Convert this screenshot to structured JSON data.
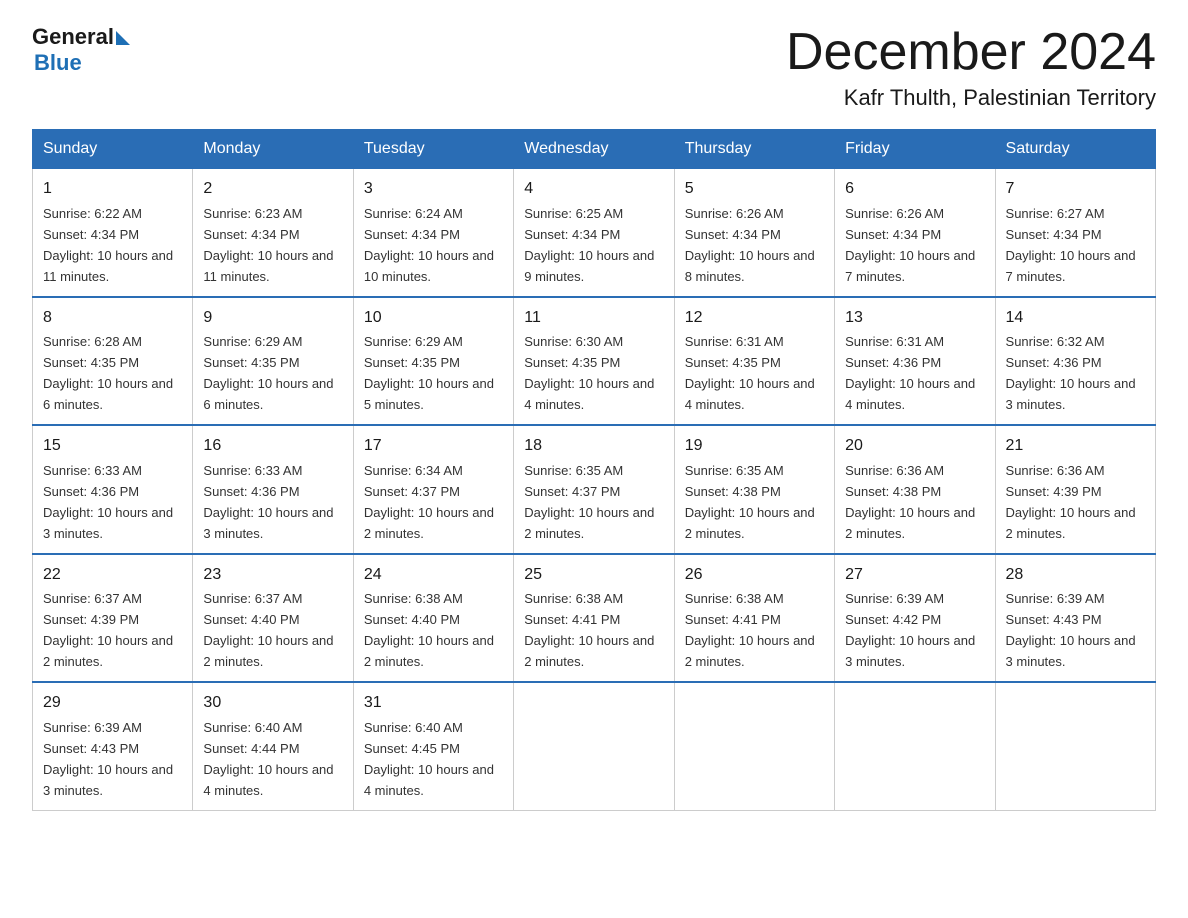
{
  "logo": {
    "general": "General",
    "blue": "Blue",
    "tagline": "Blue"
  },
  "title": "December 2024",
  "subtitle": "Kafr Thulth, Palestinian Territory",
  "days_of_week": [
    "Sunday",
    "Monday",
    "Tuesday",
    "Wednesday",
    "Thursday",
    "Friday",
    "Saturday"
  ],
  "weeks": [
    [
      {
        "num": "1",
        "sunrise": "6:22 AM",
        "sunset": "4:34 PM",
        "daylight": "10 hours and 11 minutes."
      },
      {
        "num": "2",
        "sunrise": "6:23 AM",
        "sunset": "4:34 PM",
        "daylight": "10 hours and 11 minutes."
      },
      {
        "num": "3",
        "sunrise": "6:24 AM",
        "sunset": "4:34 PM",
        "daylight": "10 hours and 10 minutes."
      },
      {
        "num": "4",
        "sunrise": "6:25 AM",
        "sunset": "4:34 PM",
        "daylight": "10 hours and 9 minutes."
      },
      {
        "num": "5",
        "sunrise": "6:26 AM",
        "sunset": "4:34 PM",
        "daylight": "10 hours and 8 minutes."
      },
      {
        "num": "6",
        "sunrise": "6:26 AM",
        "sunset": "4:34 PM",
        "daylight": "10 hours and 7 minutes."
      },
      {
        "num": "7",
        "sunrise": "6:27 AM",
        "sunset": "4:34 PM",
        "daylight": "10 hours and 7 minutes."
      }
    ],
    [
      {
        "num": "8",
        "sunrise": "6:28 AM",
        "sunset": "4:35 PM",
        "daylight": "10 hours and 6 minutes."
      },
      {
        "num": "9",
        "sunrise": "6:29 AM",
        "sunset": "4:35 PM",
        "daylight": "10 hours and 6 minutes."
      },
      {
        "num": "10",
        "sunrise": "6:29 AM",
        "sunset": "4:35 PM",
        "daylight": "10 hours and 5 minutes."
      },
      {
        "num": "11",
        "sunrise": "6:30 AM",
        "sunset": "4:35 PM",
        "daylight": "10 hours and 4 minutes."
      },
      {
        "num": "12",
        "sunrise": "6:31 AM",
        "sunset": "4:35 PM",
        "daylight": "10 hours and 4 minutes."
      },
      {
        "num": "13",
        "sunrise": "6:31 AM",
        "sunset": "4:36 PM",
        "daylight": "10 hours and 4 minutes."
      },
      {
        "num": "14",
        "sunrise": "6:32 AM",
        "sunset": "4:36 PM",
        "daylight": "10 hours and 3 minutes."
      }
    ],
    [
      {
        "num": "15",
        "sunrise": "6:33 AM",
        "sunset": "4:36 PM",
        "daylight": "10 hours and 3 minutes."
      },
      {
        "num": "16",
        "sunrise": "6:33 AM",
        "sunset": "4:36 PM",
        "daylight": "10 hours and 3 minutes."
      },
      {
        "num": "17",
        "sunrise": "6:34 AM",
        "sunset": "4:37 PM",
        "daylight": "10 hours and 2 minutes."
      },
      {
        "num": "18",
        "sunrise": "6:35 AM",
        "sunset": "4:37 PM",
        "daylight": "10 hours and 2 minutes."
      },
      {
        "num": "19",
        "sunrise": "6:35 AM",
        "sunset": "4:38 PM",
        "daylight": "10 hours and 2 minutes."
      },
      {
        "num": "20",
        "sunrise": "6:36 AM",
        "sunset": "4:38 PM",
        "daylight": "10 hours and 2 minutes."
      },
      {
        "num": "21",
        "sunrise": "6:36 AM",
        "sunset": "4:39 PM",
        "daylight": "10 hours and 2 minutes."
      }
    ],
    [
      {
        "num": "22",
        "sunrise": "6:37 AM",
        "sunset": "4:39 PM",
        "daylight": "10 hours and 2 minutes."
      },
      {
        "num": "23",
        "sunrise": "6:37 AM",
        "sunset": "4:40 PM",
        "daylight": "10 hours and 2 minutes."
      },
      {
        "num": "24",
        "sunrise": "6:38 AM",
        "sunset": "4:40 PM",
        "daylight": "10 hours and 2 minutes."
      },
      {
        "num": "25",
        "sunrise": "6:38 AM",
        "sunset": "4:41 PM",
        "daylight": "10 hours and 2 minutes."
      },
      {
        "num": "26",
        "sunrise": "6:38 AM",
        "sunset": "4:41 PM",
        "daylight": "10 hours and 2 minutes."
      },
      {
        "num": "27",
        "sunrise": "6:39 AM",
        "sunset": "4:42 PM",
        "daylight": "10 hours and 3 minutes."
      },
      {
        "num": "28",
        "sunrise": "6:39 AM",
        "sunset": "4:43 PM",
        "daylight": "10 hours and 3 minutes."
      }
    ],
    [
      {
        "num": "29",
        "sunrise": "6:39 AM",
        "sunset": "4:43 PM",
        "daylight": "10 hours and 3 minutes."
      },
      {
        "num": "30",
        "sunrise": "6:40 AM",
        "sunset": "4:44 PM",
        "daylight": "10 hours and 4 minutes."
      },
      {
        "num": "31",
        "sunrise": "6:40 AM",
        "sunset": "4:45 PM",
        "daylight": "10 hours and 4 minutes."
      },
      null,
      null,
      null,
      null
    ]
  ]
}
